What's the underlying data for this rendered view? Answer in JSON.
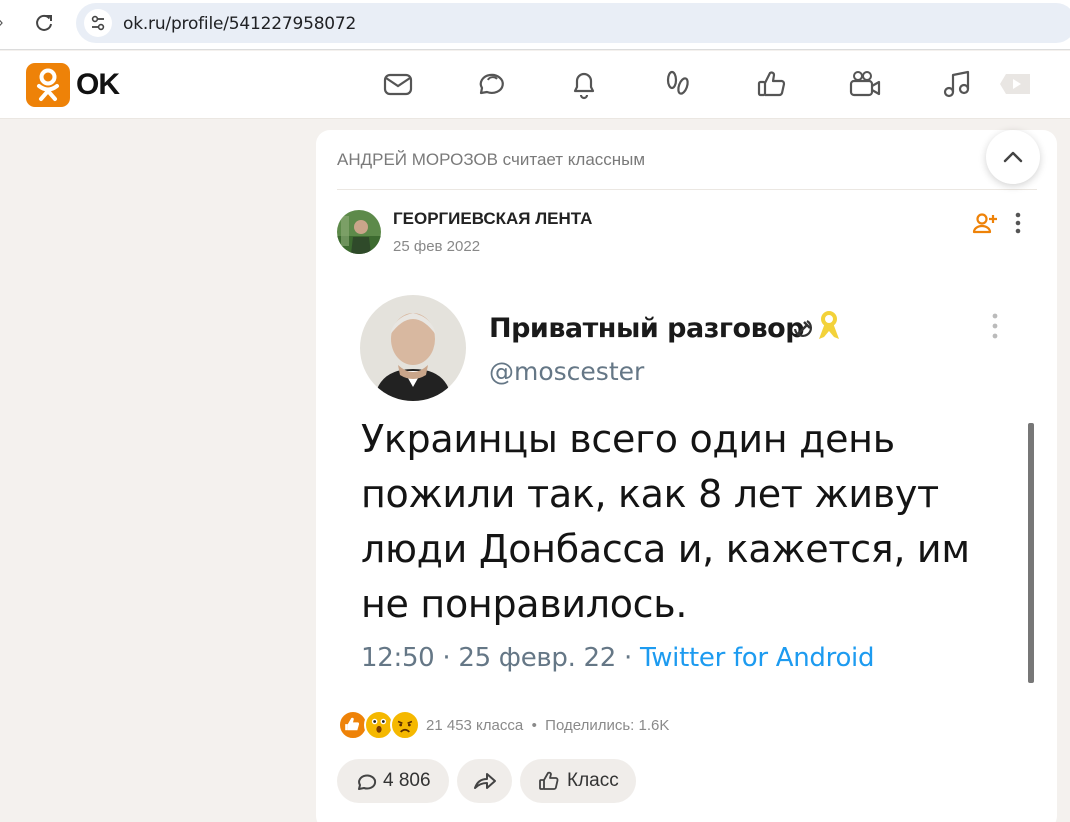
{
  "browser": {
    "url": "ok.ru/profile/541227958072"
  },
  "header": {
    "logo_text": "OK",
    "icons": [
      "mail-icon",
      "chat-icon",
      "bell-icon",
      "guests-icon",
      "like-icon",
      "video-camera-icon",
      "music-icon",
      "video-play-icon"
    ]
  },
  "post": {
    "liked_by": "АНДРЕЙ МОРОЗОВ считает классным",
    "author": "ГЕОРГИЕВСКАЯ ЛЕНТА",
    "date": "25 фев 2022",
    "tweet": {
      "name": "Приватный разговор",
      "handle": "@moscester",
      "text": "Украинцы всего один день пожили так, как 8 лет живут люди Донбасса и, кажется, им не понравилось.",
      "meta_time": "12:50 · 25 февр. 22 · ",
      "meta_source": "Twitter for Android"
    },
    "stats": {
      "likes": "21 453 класса",
      "separator": "•",
      "shares": "Поделились: 1.6K"
    },
    "actions": {
      "comments": "4 806",
      "like_label": "Класс"
    }
  },
  "colors": {
    "brand": "#ee8208",
    "background": "#f4f1ee",
    "link": "#1d9bf0"
  }
}
